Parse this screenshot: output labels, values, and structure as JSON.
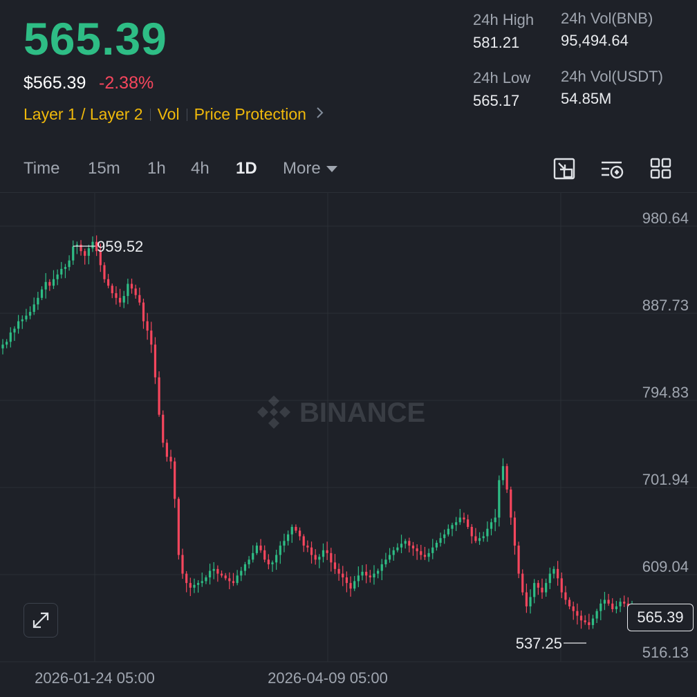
{
  "header": {
    "last_price": "565.39",
    "usd_price": "$565.39",
    "change_pct": "-2.38%",
    "tags": [
      "Layer 1 / Layer 2",
      "Vol",
      "Price Protection"
    ],
    "price_color": "#2ebd85",
    "down_color": "#f6465d",
    "tag_color": "#f0b90b"
  },
  "stats": {
    "high_label": "24h High",
    "high_value": "581.21",
    "low_label": "24h Low",
    "low_value": "565.17",
    "vol_base_label": "24h Vol(BNB)",
    "vol_base_value": "95,494.64",
    "vol_quote_label": "24h Vol(USDT)",
    "vol_quote_value": "54.85M"
  },
  "toolbar": {
    "intervals": [
      "Time",
      "15m",
      "1h",
      "4h",
      "1D"
    ],
    "active_interval": "1D",
    "more_label": "More",
    "icons": [
      "chart-settings-icon",
      "indicator-settings-icon",
      "grid-layout-icon"
    ]
  },
  "chart": {
    "watermark": "BINANCE",
    "y_ticks": [
      "980.64",
      "887.73",
      "794.83",
      "701.94",
      "609.04",
      "516.13"
    ],
    "x_ticks": [
      "2026-01-24 05:00",
      "2026-04-09 05:00"
    ],
    "max_label": "959.52",
    "min_label": "537.25",
    "current_price_label": "565.39",
    "up_color": "#2ebd85",
    "down_color": "#f6465d"
  },
  "chart_data": {
    "type": "candlestick",
    "interval": "1D",
    "y_ticks": [
      980.64,
      887.73,
      794.83,
      701.94,
      609.04,
      516.13
    ],
    "x_ticks": [
      "2026-01-24 05:00",
      "2026-04-09 05:00"
    ],
    "max_price": 959.52,
    "min_price": 537.25,
    "current_price": 565.39,
    "closes": [
      845,
      848,
      858,
      862,
      870,
      872,
      876,
      880,
      888,
      895,
      904,
      912,
      908,
      915,
      920,
      926,
      928,
      935,
      950,
      952,
      945,
      940,
      948,
      955,
      945,
      930,
      915,
      908,
      900,
      895,
      890,
      897,
      910,
      905,
      898,
      890,
      870,
      860,
      845,
      810,
      770,
      740,
      725,
      720,
      680,
      620,
      600,
      590,
      585,
      588,
      590,
      592,
      596,
      603,
      605,
      600,
      598,
      595,
      592,
      590,
      598,
      603,
      610,
      615,
      622,
      630,
      625,
      615,
      610,
      612,
      620,
      630,
      635,
      642,
      650,
      646,
      640,
      630,
      628,
      620,
      615,
      618,
      625,
      622,
      612,
      605,
      600,
      596,
      590,
      584,
      592,
      598,
      602,
      598,
      596,
      600,
      603,
      610,
      615,
      620,
      625,
      628,
      632,
      635,
      630,
      627,
      624,
      620,
      618,
      622,
      628,
      633,
      638,
      642,
      648,
      652,
      655,
      660,
      658,
      650,
      640,
      635,
      638,
      640,
      648,
      655,
      660,
      700,
      715,
      690,
      660,
      630,
      600,
      580,
      565,
      575,
      590,
      585,
      580,
      590,
      600,
      605,
      595,
      580,
      572,
      565,
      560,
      555,
      550,
      548,
      545,
      552,
      560,
      568,
      572,
      568,
      562,
      565,
      570,
      568,
      565,
      565
    ]
  }
}
